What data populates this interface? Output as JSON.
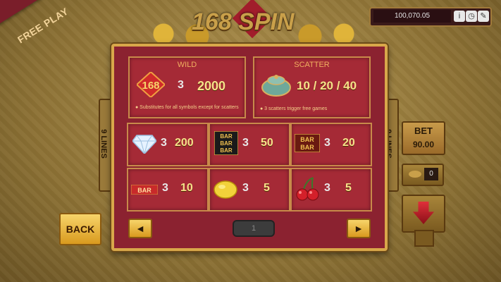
{
  "banner": {
    "free_play": "FREE PLAY"
  },
  "logo": {
    "text": "168 SPIN"
  },
  "credits": {
    "value": "100,070.05",
    "icons": [
      "info-icon",
      "history-icon",
      "settings-icon"
    ],
    "icon_glyphs": [
      "i",
      "◷",
      "✎"
    ]
  },
  "paytable": {
    "wild": {
      "title": "WILD",
      "symbol": "168",
      "count": "3",
      "payout": "2000",
      "note": "● Substitutes for all symbols except for scatters"
    },
    "scatter": {
      "title": "SCATTER",
      "payout": "10 / 20 / 40",
      "note": "● 3 scatters trigger free games"
    },
    "rows": [
      {
        "symbol": "diamond-icon",
        "count": "3",
        "payout": "200"
      },
      {
        "symbol": "triple-bar-icon",
        "count": "3",
        "payout": "50"
      },
      {
        "symbol": "double-bar-icon",
        "count": "3",
        "payout": "20"
      },
      {
        "symbol": "single-bar-icon",
        "count": "3",
        "payout": "10"
      },
      {
        "symbol": "lemon-icon",
        "count": "3",
        "payout": "5"
      },
      {
        "symbol": "cherry-icon",
        "count": "3",
        "payout": "5"
      }
    ],
    "page": "1"
  },
  "lines": {
    "left": "9 LINES",
    "right": "9 LINES"
  },
  "buttons": {
    "back": "BACK",
    "prev": "◄",
    "next": "►"
  },
  "bet": {
    "label": "BET",
    "value": "90.00"
  },
  "win": {
    "value": "0"
  }
}
